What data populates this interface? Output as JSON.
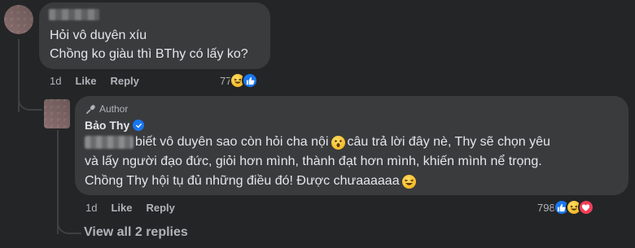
{
  "comment_1": {
    "line_1": "Hỏi vô duyên xíu",
    "line_2": "Chồng ko giàu thì BThy có lấy ko?",
    "time": "1d",
    "like_label": "Like",
    "reply_label": "Reply",
    "reaction_count": "77",
    "reaction_icons": [
      "haha-icon",
      "like-icon"
    ]
  },
  "comment_2": {
    "badge": "Author",
    "author": "Bảo Thy",
    "line_1_text": "biết vô duyên sao còn hỏi cha nội",
    "line_1_tail": "câu trả lời đây nè, Thy sẽ chọn yêu",
    "line_2": "và lấy người đạo đức, giỏi hơn mình, thành đạt hơn mình, khiến mình nể trọng.",
    "line_3": "Chồng Thy hội tụ đủ những điều đó! Được chưaaaaaa",
    "time": "1d",
    "like_label": "Like",
    "reply_label": "Reply",
    "reaction_count": "798",
    "reaction_icons": [
      "like-icon",
      "haha-icon",
      "love-icon"
    ]
  },
  "view_all_label": "View all 2 replies",
  "colors": {
    "background": "#242526",
    "bubble": "#3a3b3c",
    "text": "#e4e6eb",
    "secondary": "#b0b3b8",
    "like_blue": "#1877f2",
    "love_red": "#f33e58"
  }
}
